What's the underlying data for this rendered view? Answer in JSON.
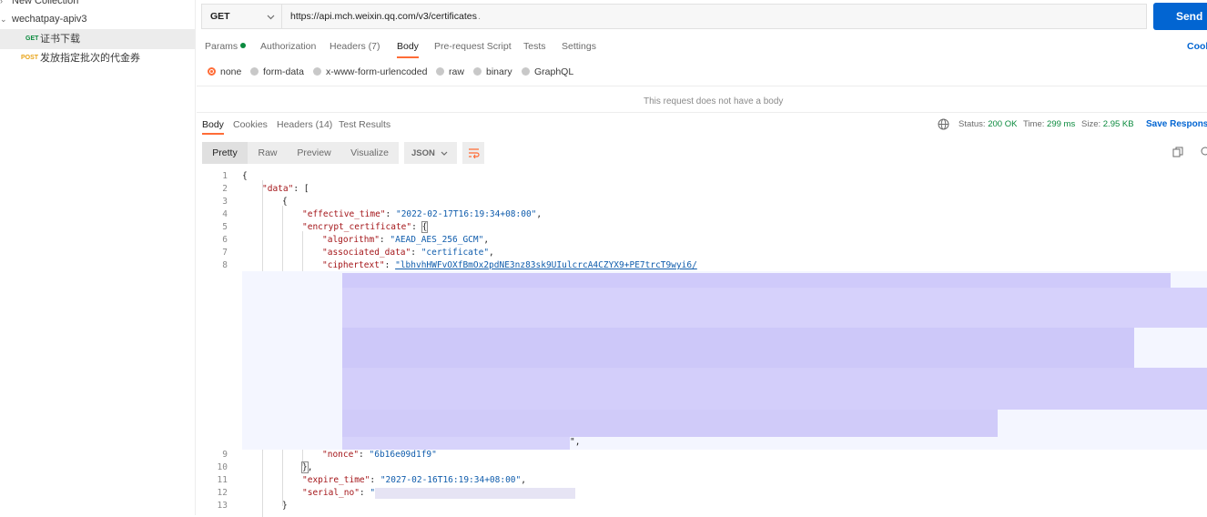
{
  "sidebar": {
    "collection_new": "New Collection",
    "collection": "wechatpay-apiv3",
    "requests": [
      {
        "method": "GET",
        "name": "证书下载"
      },
      {
        "method": "POST",
        "name": "发放指定批次的代金券"
      }
    ]
  },
  "request": {
    "method": "GET",
    "url": "https://api.mch.weixin.qq.com/v3/certificates",
    "send_label": "Send",
    "cookies_label": "Cook",
    "tabs": [
      "Params",
      "Authorization",
      "Headers (7)",
      "Body",
      "Pre-request Script",
      "Tests",
      "Settings"
    ],
    "body_types": [
      "none",
      "form-data",
      "x-www-form-urlencoded",
      "raw",
      "binary",
      "GraphQL"
    ],
    "no_body_text": "This request does not have a body"
  },
  "response": {
    "tabs": [
      "Body",
      "Cookies",
      "Headers (14)",
      "Test Results"
    ],
    "status_label": "Status:",
    "status_value": "200 OK",
    "time_label": "Time:",
    "time_value": "299 ms",
    "size_label": "Size:",
    "size_value": "2.95 KB",
    "save_label": "Save Response",
    "view_tabs": [
      "Pretty",
      "Raw",
      "Preview",
      "Visualize"
    ],
    "format": "JSON",
    "code": {
      "effective_time": "\"2022-02-17T16:19:34+08:00\"",
      "algorithm": "\"AEAD_AES_256_GCM\"",
      "associated_data": "\"certificate\"",
      "ciphertext": "\"lbhvhHWFvOXfBmOx2pdNE3nz83sk9UIulcrcA4CZYX9+PE7trcT9wyi6/",
      "nonce": "\"6b16e09d1f9\"",
      "expire_time": "\"2027-02-16T16:19:34+08:00\"",
      "serial_no": "\"\""
    }
  },
  "colors": {
    "accent": "#ff6c37",
    "send": "#0265d2",
    "status_ok": "#0b8a3e",
    "blur": "#cfcafa"
  }
}
